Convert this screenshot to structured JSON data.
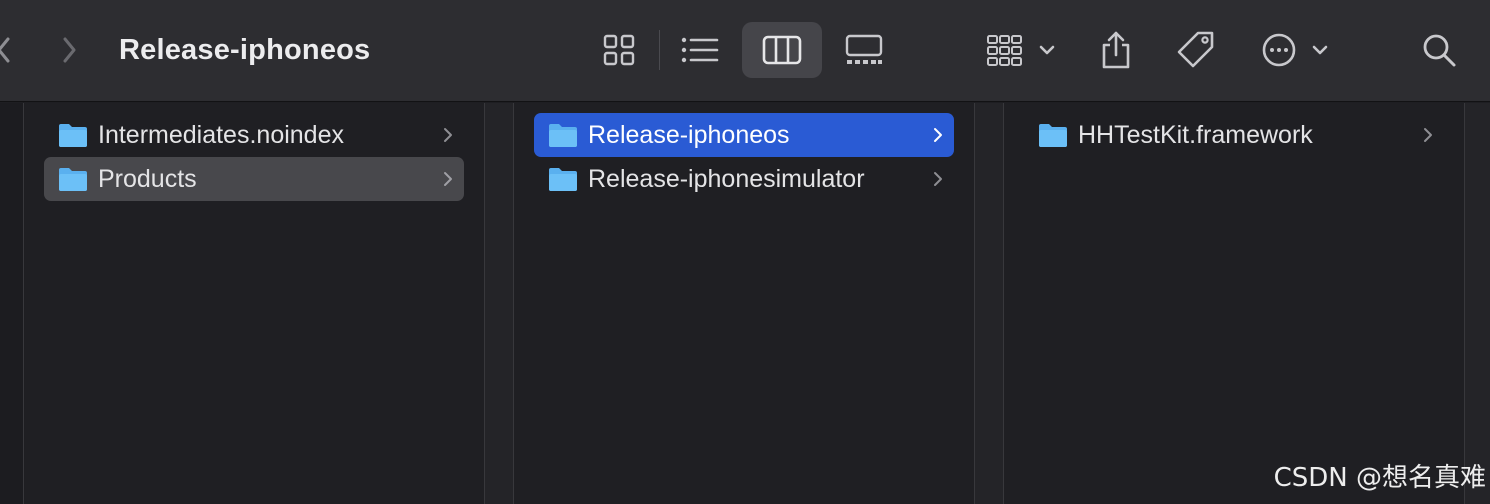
{
  "window": {
    "title": "Release-iphoneos"
  },
  "toolbar": {
    "back_icon": "chevron-left-icon",
    "forward_icon": "chevron-right-icon",
    "view_modes": [
      "icon-view-icon",
      "list-view-icon",
      "column-view-icon",
      "gallery-view-icon"
    ],
    "active_view": "column-view-icon",
    "group_icon": "group-by-icon",
    "share_icon": "share-icon",
    "tag_icon": "tag-icon",
    "more_icon": "more-actions-icon",
    "search_icon": "search-icon"
  },
  "columns": [
    {
      "items": [
        {
          "label": "Intermediates.noindex",
          "has_children": true,
          "selected": false
        },
        {
          "label": "Products",
          "has_children": true,
          "selected": "inactive"
        }
      ]
    },
    {
      "items": [
        {
          "label": "Release-iphoneos",
          "has_children": true,
          "selected": "active"
        },
        {
          "label": "Release-iphonesimulator",
          "has_children": true,
          "selected": false
        }
      ]
    },
    {
      "items": [
        {
          "label": "HHTestKit.framework",
          "has_children": true,
          "selected": false
        }
      ]
    }
  ],
  "colors": {
    "selection_active": "#2a5bd4",
    "selection_inactive": "#48484c",
    "folder": "#5ab0ef"
  },
  "watermark": "CSDN @想名真难"
}
